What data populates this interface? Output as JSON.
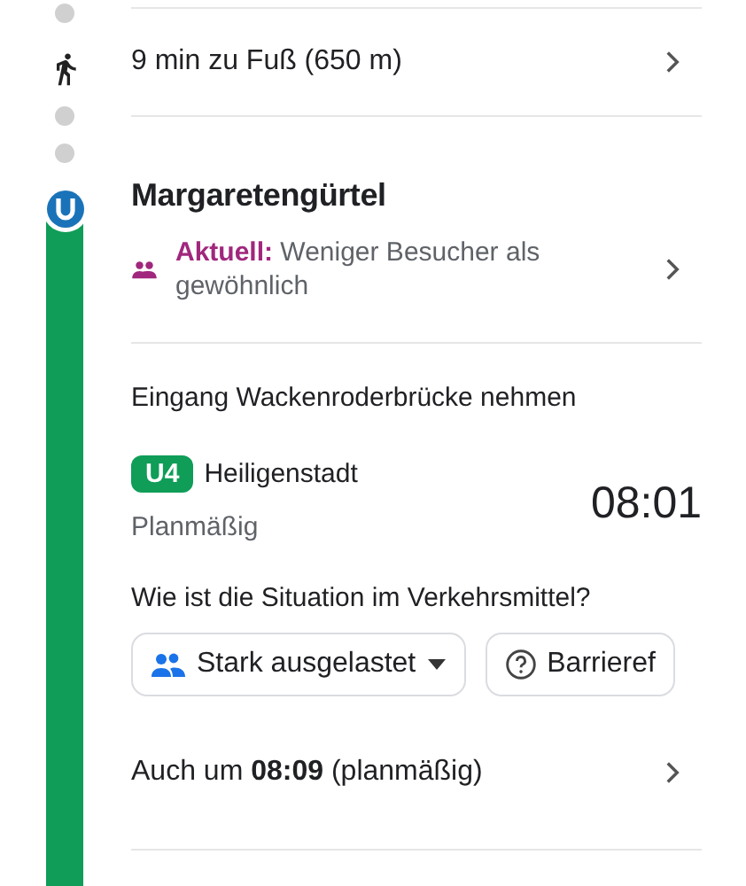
{
  "walk": {
    "text": "9 min zu Fuß (650 m)"
  },
  "station": {
    "name": "Margaretengürtel",
    "crowd_label": "Aktuell:",
    "crowd_text": "Weniger Besucher als gewöhnlich"
  },
  "entrance": "Eingang Wackenroderbrücke nehmen",
  "departure": {
    "line": "U4",
    "color": "#0f9d58",
    "destination": "Heiligenstadt",
    "status": "Planmäßig",
    "time": "08:01"
  },
  "question": "Wie ist die Situation im Verkehrsmittel?",
  "chips": [
    {
      "kind": "dropdown",
      "label": "Stark ausgelastet"
    },
    {
      "kind": "info",
      "label": "Barrieref"
    }
  ],
  "later": "Auch um **08:09** (planmäßig)"
}
